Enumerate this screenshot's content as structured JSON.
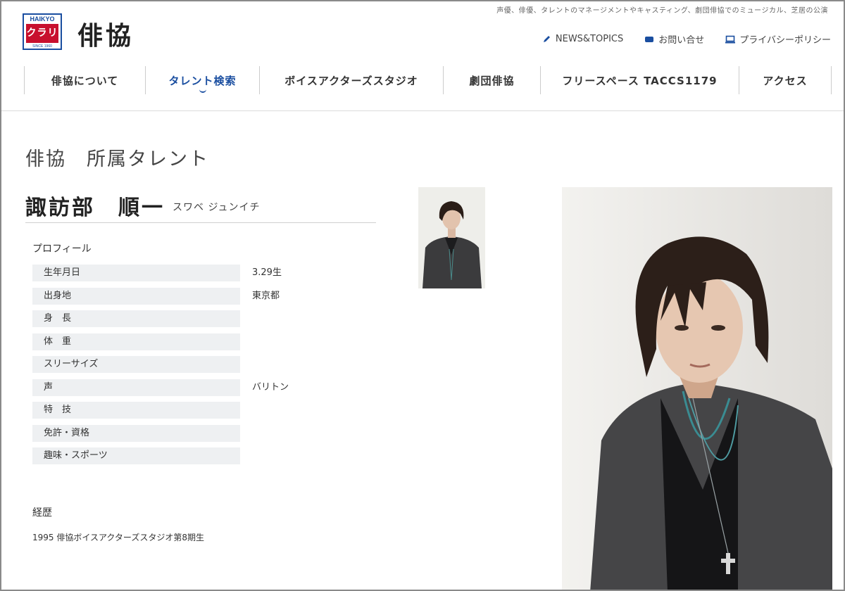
{
  "header": {
    "tagline": "声優、俳優、タレントのマネージメントやキャスティング、劇団俳協でのミュージカル、芝居の公演",
    "logo": {
      "top_text": "HAIKYO",
      "main_text": "クラリ",
      "bottom_text": "SINCE 1960"
    },
    "site_name": "俳協",
    "utility_links": [
      {
        "label": "NEWS&TOPICS",
        "icon": "pencil-icon"
      },
      {
        "label": "お問い合せ",
        "icon": "mail-icon"
      },
      {
        "label": "プライバシーポリシー",
        "icon": "monitor-icon"
      }
    ],
    "accent_color": "#1a4ea0"
  },
  "nav": {
    "items": [
      {
        "label": "俳協について"
      },
      {
        "label": "タレント検索",
        "active": true
      },
      {
        "label": "ボイスアクターズスタジオ"
      },
      {
        "label": "劇団俳協"
      },
      {
        "label": "フリースペース TACCS1179"
      },
      {
        "label": "アクセス"
      }
    ]
  },
  "main": {
    "page_title": "俳協　所属タレント",
    "talent": {
      "name": "諏訪部　順一",
      "kana": "スワベ ジュンイチ"
    },
    "profile": {
      "heading": "プロフィール",
      "rows": [
        {
          "label": "生年月日",
          "value": "3.29生"
        },
        {
          "label": "出身地",
          "value": "東京都"
        },
        {
          "label": "身　長",
          "value": ""
        },
        {
          "label": "体　重",
          "value": ""
        },
        {
          "label": "スリーサイズ",
          "value": ""
        },
        {
          "label": "声",
          "value": "バリトン"
        },
        {
          "label": "特　技",
          "value": ""
        },
        {
          "label": "免許・資格",
          "value": ""
        },
        {
          "label": "趣味・スポーツ",
          "value": ""
        }
      ]
    },
    "career": {
      "heading": "経歴",
      "entries": [
        "1995 俳協ボイスアクターズスタジオ第8期生"
      ]
    }
  }
}
